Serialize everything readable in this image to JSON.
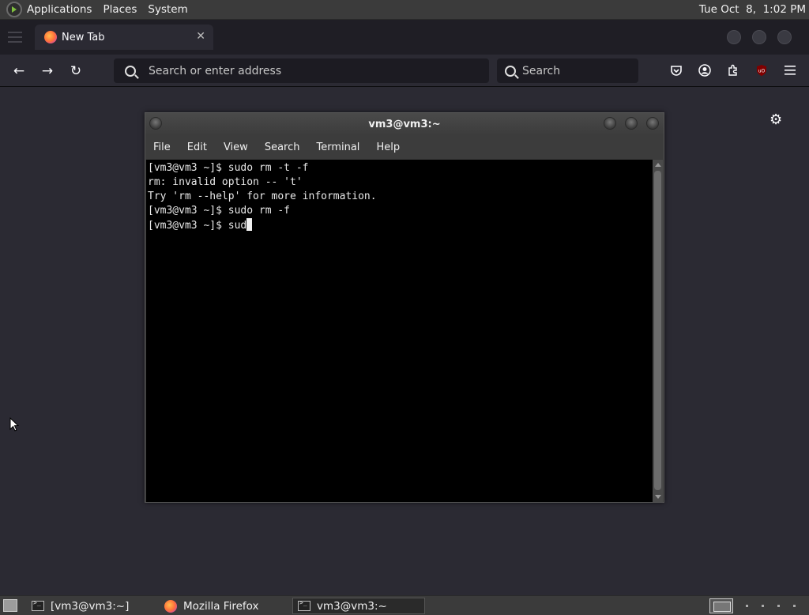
{
  "top_panel": {
    "menus": [
      "Applications",
      "Places",
      "System"
    ],
    "clock": "Tue Oct  8,  1:02 PM"
  },
  "browser": {
    "tab_title": "New Tab",
    "url_placeholder": "Search or enter address",
    "search_placeholder": "Search",
    "toolbar_icons": [
      "pocket-icon",
      "account-icon",
      "extensions-icon",
      "ublock-icon",
      "menu-icon"
    ]
  },
  "terminal": {
    "title": "vm3@vm3:~",
    "menus": [
      "File",
      "Edit",
      "View",
      "Search",
      "Terminal",
      "Help"
    ],
    "lines": [
      "[vm3@vm3 ~]$ sudo rm -t -f",
      "rm: invalid option -- 't'",
      "Try 'rm --help' for more information.",
      "[vm3@vm3 ~]$ sudo rm -f",
      "[vm3@vm3 ~]$ sud"
    ]
  },
  "taskbar": {
    "tasks": [
      {
        "label": "[vm3@vm3:~]",
        "icon": "terminal-icon",
        "active": false
      },
      {
        "label": "Mozilla Firefox",
        "icon": "firefox-icon",
        "active": false
      },
      {
        "label": "vm3@vm3:~",
        "icon": "terminal-icon",
        "active": true
      }
    ]
  }
}
